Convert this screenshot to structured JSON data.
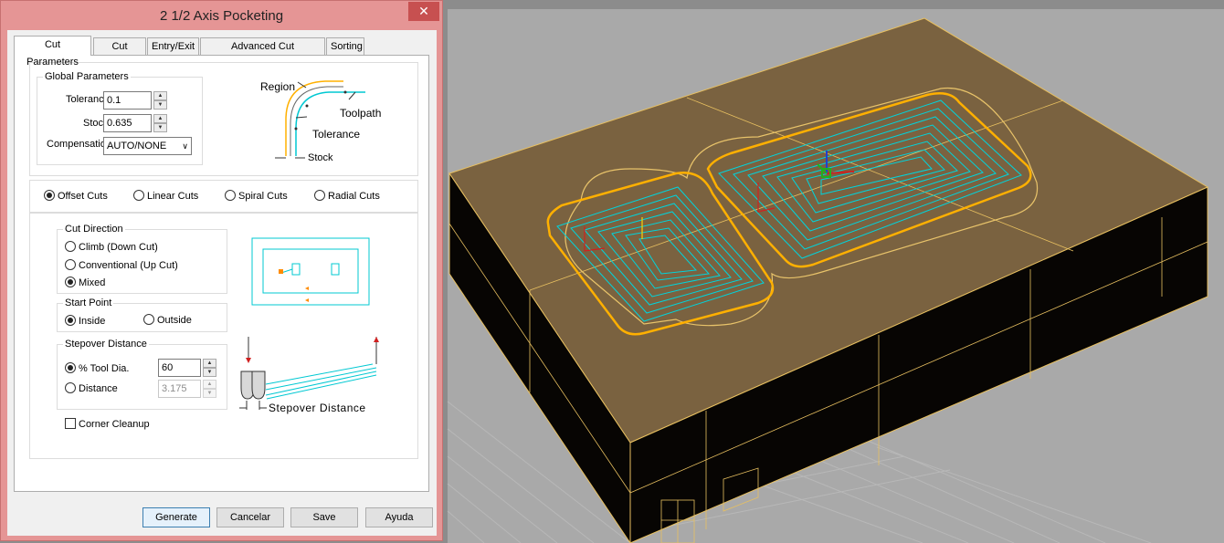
{
  "window": {
    "title": "2 1/2 Axis Pocketing",
    "close_glyph": "✕"
  },
  "tabs": [
    "Cut Parameters",
    "Cut Levels",
    "Entry/Exit",
    "Advanced Cut Parameters",
    "Sorting"
  ],
  "global_parameters": {
    "title": "Global Parameters",
    "tolerance_label": "Tolerance:",
    "tolerance_value": "0.1",
    "stock_label": "Stock:",
    "stock_value": "0.635",
    "compensation_label": "Compensation:",
    "compensation_value": "AUTO/NONE"
  },
  "region_diagram": {
    "region": "Region",
    "toolpath": "Toolpath",
    "tolerance": "Tolerance",
    "stock": "Stock"
  },
  "cut_types": {
    "offset": "Offset Cuts",
    "linear": "Linear Cuts",
    "spiral": "Spiral Cuts",
    "radial": "Radial Cuts",
    "selected": "offset"
  },
  "cut_direction": {
    "title": "Cut Direction",
    "climb": "Climb (Down Cut)",
    "conventional": "Conventional (Up Cut)",
    "mixed": "Mixed",
    "selected": "mixed"
  },
  "start_point": {
    "title": "Start Point",
    "inside": "Inside",
    "outside": "Outside",
    "selected": "inside"
  },
  "stepover": {
    "title": "Stepover Distance",
    "tool_dia_label": "% Tool Dia.",
    "tool_dia_value": "60",
    "distance_label": "Distance",
    "distance_value": "3.175",
    "selected": "tool_dia",
    "diagram_label": "Stepover Distance"
  },
  "corner_cleanup": {
    "label": "Corner Cleanup",
    "checked": false
  },
  "buttons": {
    "generate": "Generate",
    "cancel": "Cancelar",
    "save": "Save",
    "help": "Ayuda"
  },
  "colors": {
    "title_bar": "#e59595",
    "model": "#7a6240",
    "toolpath": "#00d4dc",
    "outline": "#ffb000",
    "grid": "#b4b4b4"
  }
}
